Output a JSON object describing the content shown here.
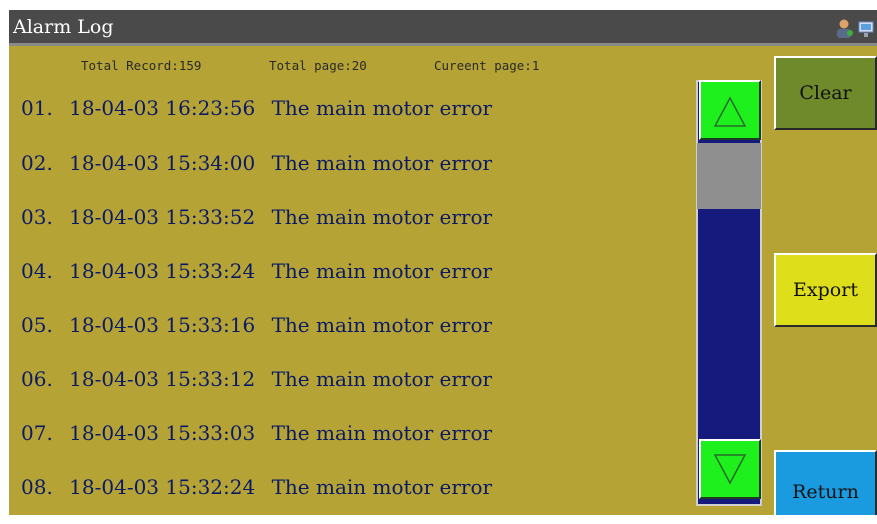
{
  "window": {
    "title": "Alarm Log"
  },
  "stats": {
    "total_record": "Total Record:159",
    "total_page": "Total page:20",
    "current_page": "Cureent page:1"
  },
  "rows": [
    {
      "index": "01.",
      "datetime": "18-04-03 16:23:56",
      "message": "The main motor error"
    },
    {
      "index": "02.",
      "datetime": "18-04-03 15:34:00",
      "message": "The main motor error"
    },
    {
      "index": "03.",
      "datetime": "18-04-03 15:33:52",
      "message": "The main motor error"
    },
    {
      "index": "04.",
      "datetime": "18-04-03 15:33:24",
      "message": "The main motor error"
    },
    {
      "index": "05.",
      "datetime": "18-04-03 15:33:16",
      "message": "The main motor error"
    },
    {
      "index": "06.",
      "datetime": "18-04-03 15:33:12",
      "message": "The main motor error"
    },
    {
      "index": "07.",
      "datetime": "18-04-03 15:33:03",
      "message": "The main motor error"
    },
    {
      "index": "08.",
      "datetime": "18-04-03 15:32:24",
      "message": "The main motor error"
    }
  ],
  "buttons": {
    "clear": "Clear",
    "export": "Export",
    "return": "Return"
  },
  "icons": {
    "user": "user-icon",
    "network": "network-icon",
    "scroll_up": "triangle-up-icon",
    "scroll_down": "triangle-down-icon"
  },
  "colors": {
    "background": "#b5a335",
    "titlebar": "#4a4a4a",
    "text": "#0b1a66",
    "scroll_track": "#151a7c",
    "scroll_thumb": "#8f8f8f",
    "arrow": "#1ef01e",
    "clear": "#6e8a2b",
    "export": "#dede1a",
    "return": "#1a9be0"
  }
}
